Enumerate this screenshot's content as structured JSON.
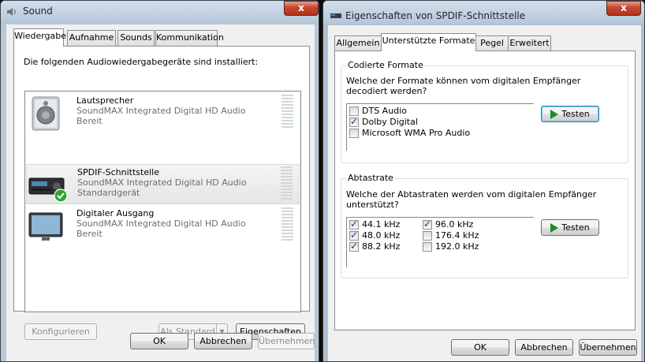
{
  "sound": {
    "title": "Sound",
    "close_glyph": "x",
    "tabs": [
      {
        "label": "Wiedergabe",
        "active": true
      },
      {
        "label": "Aufnahme"
      },
      {
        "label": "Sounds"
      },
      {
        "label": "Kommunikation"
      }
    ],
    "intro": "Die folgenden Audiowiedergabegeräte sind installiert:",
    "devices": [
      {
        "name": "Lautsprecher",
        "driver": "SoundMAX Integrated Digital HD Audio",
        "status": "Bereit",
        "icon": "speaker-icon"
      },
      {
        "name": "SPDIF-Schnittstelle",
        "driver": "SoundMAX Integrated Digital HD Audio",
        "status": "Standardgerät",
        "icon": "receiver-icon",
        "selected": true,
        "default": true
      },
      {
        "name": "Digitaler Ausgang",
        "driver": "SoundMAX Integrated Digital HD Audio",
        "status": "Bereit",
        "icon": "monitor-icon"
      }
    ],
    "buttons": {
      "configure": "Konfigurieren",
      "set_default": "Als Standard",
      "properties": "Eigenschaften",
      "ok": "OK",
      "cancel": "Abbrechen",
      "apply": "Übernehmen"
    }
  },
  "props": {
    "title": "Eigenschaften von SPDIF-Schnittstelle",
    "close_glyph": "x",
    "tabs": [
      {
        "label": "Allgemein"
      },
      {
        "label": "Unterstützte Formate",
        "active": true
      },
      {
        "label": "Pegel"
      },
      {
        "label": "Erweitert"
      }
    ],
    "encoded": {
      "label": "Codierte Formate",
      "question": "Welche der Formate können vom digitalen Empfänger decodiert werden?",
      "formats": [
        {
          "label": "DTS Audio",
          "checked": false
        },
        {
          "label": "Dolby Digital",
          "checked": true
        },
        {
          "label": "Microsoft WMA Pro Audio",
          "checked": false
        }
      ],
      "test_label": "Testen"
    },
    "rates": {
      "label": "Abtastrate",
      "question": "Welche der Abtastraten werden vom digitalen Empfänger unterstützt?",
      "col1": [
        {
          "label": "44.1 kHz",
          "checked": true
        },
        {
          "label": "48.0 kHz",
          "checked": true
        },
        {
          "label": "88.2 kHz",
          "checked": true
        }
      ],
      "col2": [
        {
          "label": "96.0 kHz",
          "checked": true
        },
        {
          "label": "176.4 kHz",
          "checked": false
        },
        {
          "label": "192.0 kHz",
          "checked": false
        }
      ],
      "test_label": "Testen"
    },
    "buttons": {
      "ok": "OK",
      "cancel": "Abbrechen",
      "apply": "Übernehmen"
    }
  }
}
